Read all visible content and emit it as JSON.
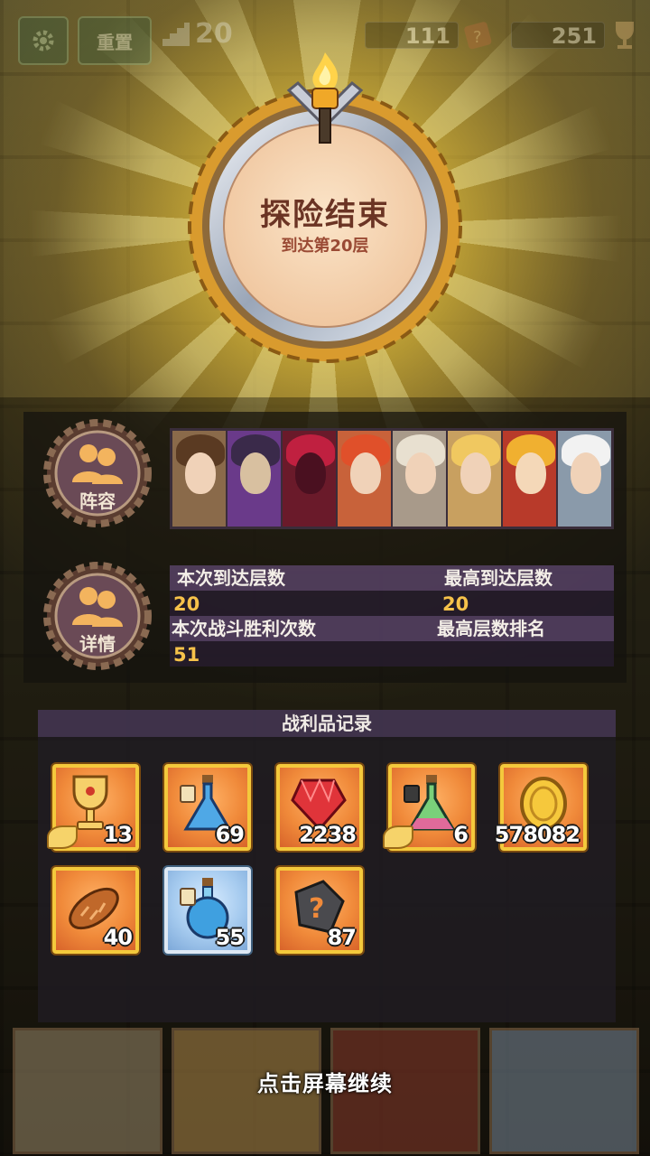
{
  "topbar": {
    "reset_label": "重置",
    "floor_value": "20",
    "stat1_value": "111",
    "stat2_value": "251"
  },
  "medal": {
    "title": "探险结束",
    "subtitle": "到达第20层"
  },
  "lineup": {
    "badge_label": "阵容",
    "heroes": [
      "hero-1",
      "hero-2",
      "hero-3",
      "hero-4",
      "hero-5",
      "hero-6",
      "hero-7",
      "hero-8"
    ]
  },
  "details": {
    "badge_label": "详情",
    "current_floor_label": "本次到达层数",
    "current_floor_value": "20",
    "max_floor_label": "最高到达层数",
    "max_floor_value": "20",
    "wins_label": "本次战斗胜利次数",
    "wins_value": "51",
    "rank_label": "最高层数排名",
    "rank_value": ""
  },
  "loot": {
    "title": "战利品记录",
    "items": [
      {
        "icon": "chalice-icon",
        "count": "13"
      },
      {
        "icon": "blue-potion-icon",
        "count": "69"
      },
      {
        "icon": "ruby-icon",
        "count": "2238"
      },
      {
        "icon": "mystery-potion-icon",
        "count": "6"
      },
      {
        "icon": "gold-coin-icon",
        "count": "578082"
      },
      {
        "icon": "bread-icon",
        "count": "40"
      },
      {
        "icon": "round-potion-icon",
        "count": "55"
      },
      {
        "icon": "mystery-stone-icon",
        "count": "87"
      }
    ]
  },
  "footer": {
    "continue_text": "点击屏幕继续"
  },
  "colors": {
    "accent_gold": "#f4c93c",
    "value_orange": "#f6c24a",
    "panel_purple": "#5a4670"
  }
}
